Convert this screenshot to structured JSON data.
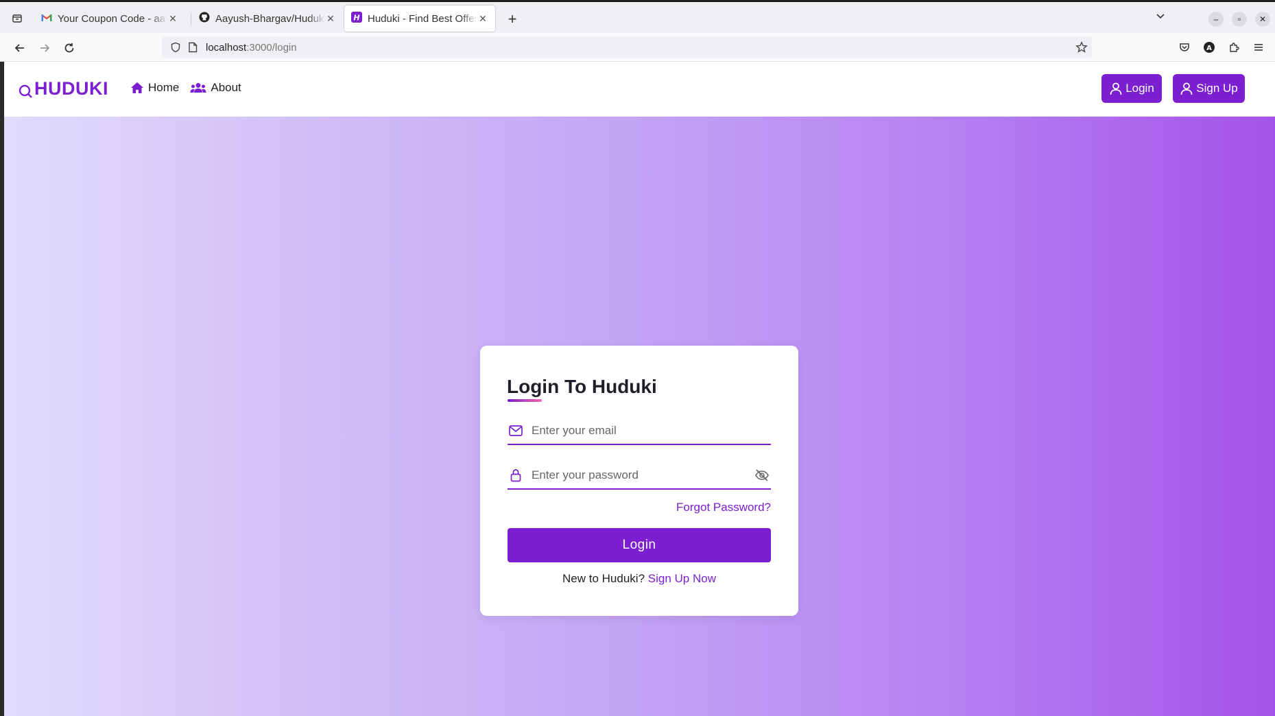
{
  "browser": {
    "tabs": [
      {
        "title": "Your Coupon Code - aayush",
        "icon": "gmail-icon",
        "active": false
      },
      {
        "title": "Aayush-Bhargav/Huduki-Find",
        "icon": "github-icon",
        "active": false
      },
      {
        "title": "Huduki - Find Best Offers",
        "icon": "huduki-favicon",
        "active": true
      }
    ],
    "url_host": "localhost",
    "url_path": ":3000/login"
  },
  "header": {
    "logo_text": "HUDUKI",
    "nav": [
      {
        "label": "Home",
        "icon": "home-icon"
      },
      {
        "label": "About",
        "icon": "users-icon"
      }
    ],
    "login_label": "Login",
    "signup_label": "Sign Up"
  },
  "login_form": {
    "title": "Login To Huduki",
    "email_placeholder": "Enter your email",
    "password_placeholder": "Enter your password",
    "forgot_label": "Forgot Password?",
    "submit_label": "Login",
    "new_user_text": "New to Huduki?",
    "signup_link": "Sign Up Now"
  },
  "colors": {
    "accent": "#7b1fd0",
    "gradient_start": "#e0dcfb",
    "gradient_end": "#a652ea"
  }
}
